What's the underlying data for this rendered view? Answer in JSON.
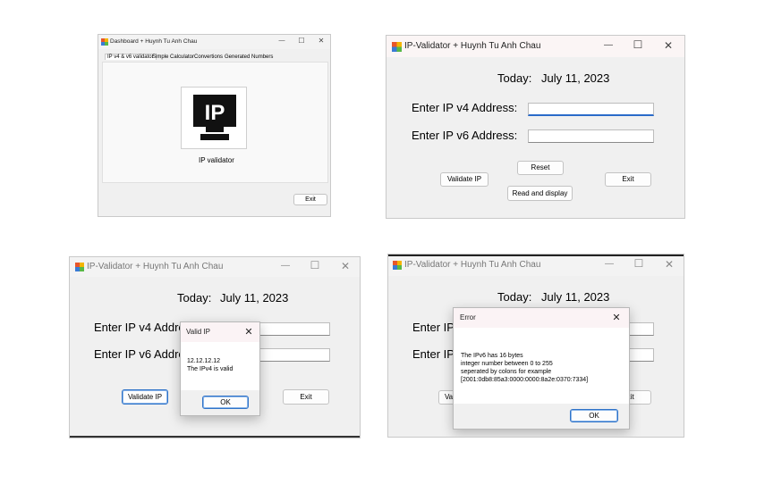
{
  "panel1": {
    "title": "Dashboard + Huynh Tu Anh Chau",
    "tabs": [
      "IP v4 & v6 validator",
      "Simple Calculator",
      "Convertions",
      "Generated Numbers"
    ],
    "tile_label": "IP validator",
    "tile_icon_text": "IP",
    "exit_label": "Exit",
    "minimize": "—",
    "maximize": "☐",
    "close": "✕"
  },
  "panel2": {
    "title": "IP-Validator + Huynh Tu Anh Chau",
    "today_label": "Today:",
    "date": "July 11, 2023",
    "ipv4_label": "Enter IP v4 Address:",
    "ipv6_label": "Enter IP v6 Address:",
    "ipv4_value": "",
    "ipv6_value": "",
    "validate_label": "Validate IP",
    "reset_label": "Reset",
    "read_display_label": "Read and display",
    "exit_label": "Exit",
    "minimize": "—",
    "maximize": "☐",
    "close": "✕"
  },
  "panel3": {
    "title": "IP-Validator + Huynh Tu Anh Chau",
    "today_label": "Today:",
    "date": "July 11, 2023",
    "ipv4_label": "Enter IP v4 Address:",
    "ipv6_label": "Enter IP v6 Address:",
    "validate_label": "Validate IP",
    "exit_label": "Exit",
    "minimize": "—",
    "maximize": "☐",
    "close": "✕",
    "dialog": {
      "title": "Valid IP",
      "line1": "12.12.12.12",
      "line2": "The IPv4 is valid",
      "ok_label": "OK",
      "close": "✕"
    }
  },
  "panel4": {
    "title": "IP-Validator + Huynh Tu Anh Chau",
    "today_label": "Today:",
    "date": "July 11, 2023",
    "ipv4_label": "Enter IP v4 Address:",
    "ipv6_label": "Enter IP v6 Address:",
    "validate_label": "Validate IP",
    "exit_label": "Exit",
    "minimize": "—",
    "maximize": "☐",
    "close": "✕",
    "dialog": {
      "title": "Error",
      "line1": "The IPv6 has 16 bytes",
      "line2": "integer number between 0 to 255",
      "line3": "seperated by colons for example",
      "line4": "[2001:0db8:85a3:0000:0000:8a2e:0370:7334]",
      "ok_label": "OK",
      "close": "✕"
    }
  }
}
